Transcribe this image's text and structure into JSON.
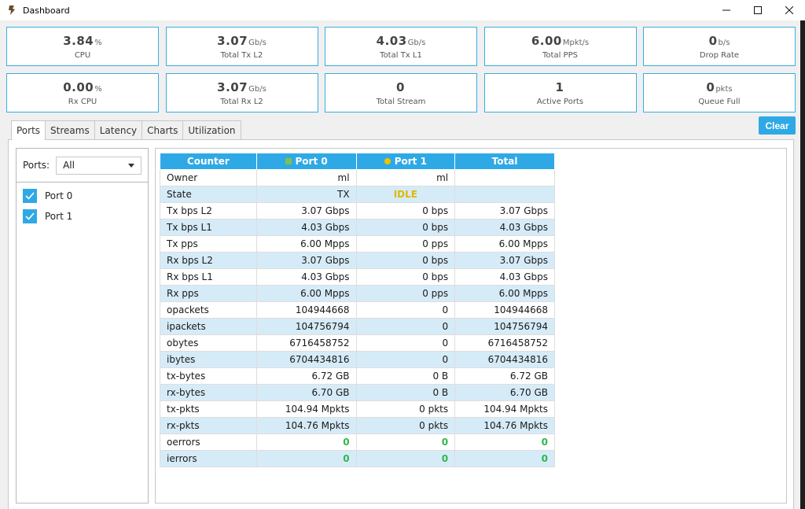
{
  "window": {
    "title": "Dashboard",
    "minimize": "—",
    "maximize": "☐",
    "close": "✕"
  },
  "stats": [
    {
      "value": "3.84",
      "unit": "%",
      "label": "CPU"
    },
    {
      "value": "3.07",
      "unit": "Gb/s",
      "label": "Total Tx L2"
    },
    {
      "value": "4.03",
      "unit": "Gb/s",
      "label": "Total Tx L1"
    },
    {
      "value": "6.00",
      "unit": "Mpkt/s",
      "label": "Total PPS"
    },
    {
      "value": "0",
      "unit": "b/s",
      "label": "Drop Rate"
    },
    {
      "value": "0.00",
      "unit": "%",
      "label": "Rx CPU"
    },
    {
      "value": "3.07",
      "unit": "Gb/s",
      "label": "Total Rx L2"
    },
    {
      "value": "0",
      "unit": "",
      "label": "Total Stream"
    },
    {
      "value": "1",
      "unit": "",
      "label": "Active Ports"
    },
    {
      "value": "0",
      "unit": "pkts",
      "label": "Queue Full"
    }
  ],
  "clear_label": "Clear",
  "tabs": [
    {
      "label": "Ports",
      "active": true
    },
    {
      "label": "Streams"
    },
    {
      "label": "Latency"
    },
    {
      "label": "Charts"
    },
    {
      "label": "Utilization"
    }
  ],
  "ports_panel": {
    "filter_label": "Ports:",
    "filter_value": "All",
    "items": [
      {
        "label": "Port 0",
        "checked": true
      },
      {
        "label": "Port 1",
        "checked": true
      }
    ]
  },
  "table": {
    "headers": {
      "counter": "Counter",
      "port0": "Port 0",
      "port1": "Port 1",
      "total": "Total"
    },
    "port0_color": "#7cc24f",
    "port1_color": "#f2c200",
    "rows": [
      {
        "counter": "Owner",
        "port0": "ml",
        "port1": "ml",
        "total": ""
      },
      {
        "counter": "State",
        "port0": "TX",
        "port1": "IDLE",
        "total": ""
      },
      {
        "counter": "Tx bps L2",
        "port0": "3.07 Gbps",
        "port1": "0 bps",
        "total": "3.07 Gbps"
      },
      {
        "counter": "Tx bps L1",
        "port0": "4.03 Gbps",
        "port1": "0 bps",
        "total": "4.03 Gbps"
      },
      {
        "counter": "Tx pps",
        "port0": "6.00 Mpps",
        "port1": "0 pps",
        "total": "6.00 Mpps"
      },
      {
        "counter": "Rx bps L2",
        "port0": "3.07 Gbps",
        "port1": "0 bps",
        "total": "3.07 Gbps"
      },
      {
        "counter": "Rx bps L1",
        "port0": "4.03 Gbps",
        "port1": "0 bps",
        "total": "4.03 Gbps"
      },
      {
        "counter": "Rx pps",
        "port0": "6.00 Mpps",
        "port1": "0 pps",
        "total": "6.00 Mpps"
      },
      {
        "counter": "opackets",
        "port0": "104944668",
        "port1": "0",
        "total": "104944668"
      },
      {
        "counter": "ipackets",
        "port0": "104756794",
        "port1": "0",
        "total": "104756794"
      },
      {
        "counter": "obytes",
        "port0": "6716458752",
        "port1": "0",
        "total": "6716458752"
      },
      {
        "counter": "ibytes",
        "port0": "6704434816",
        "port1": "0",
        "total": "6704434816"
      },
      {
        "counter": "tx-bytes",
        "port0": "6.72 GB",
        "port1": "0 B",
        "total": "6.72 GB"
      },
      {
        "counter": "rx-bytes",
        "port0": "6.70 GB",
        "port1": "0 B",
        "total": "6.70 GB"
      },
      {
        "counter": "tx-pkts",
        "port0": "104.94 Mpkts",
        "port1": "0 pkts",
        "total": "104.94 Mpkts"
      },
      {
        "counter": "rx-pkts",
        "port0": "104.76 Mpkts",
        "port1": "0 pkts",
        "total": "104.76 Mpkts"
      },
      {
        "counter": "oerrors",
        "port0": "0",
        "port1": "0",
        "total": "0",
        "highlight": true
      },
      {
        "counter": "ierrors",
        "port0": "0",
        "port1": "0",
        "total": "0",
        "highlight": true
      }
    ]
  }
}
